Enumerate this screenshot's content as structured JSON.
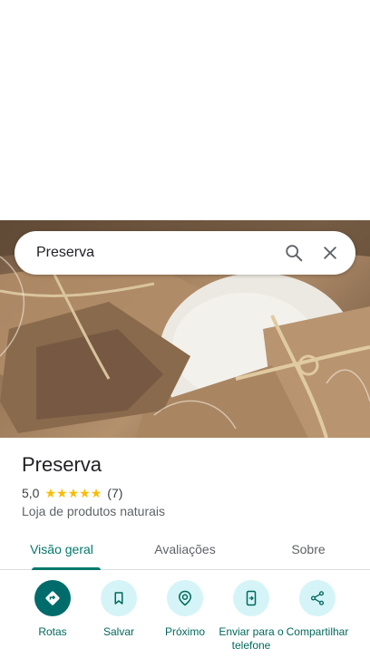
{
  "search": {
    "value": "Preserva"
  },
  "place": {
    "name": "Preserva",
    "rating": "5,0",
    "stars": 5,
    "review_count": "(7)",
    "category": "Loja de produtos naturais"
  },
  "tabs": [
    {
      "label": "Visão geral",
      "active": true
    },
    {
      "label": "Avaliações",
      "active": false
    },
    {
      "label": "Sobre",
      "active": false
    }
  ],
  "actions": [
    {
      "label": "Rotas",
      "icon": "directions-icon"
    },
    {
      "label": "Salvar",
      "icon": "bookmark-icon"
    },
    {
      "label": "Próximo",
      "icon": "nearby-icon"
    },
    {
      "label": "Enviar para o telefone",
      "icon": "send-to-phone-icon"
    },
    {
      "label": "Compartilhar",
      "icon": "share-icon"
    }
  ],
  "colors": {
    "accent": "#00796b",
    "star": "#fbbc04",
    "action_bg": "#d4f4f8",
    "primary_action": "#006b6b"
  }
}
